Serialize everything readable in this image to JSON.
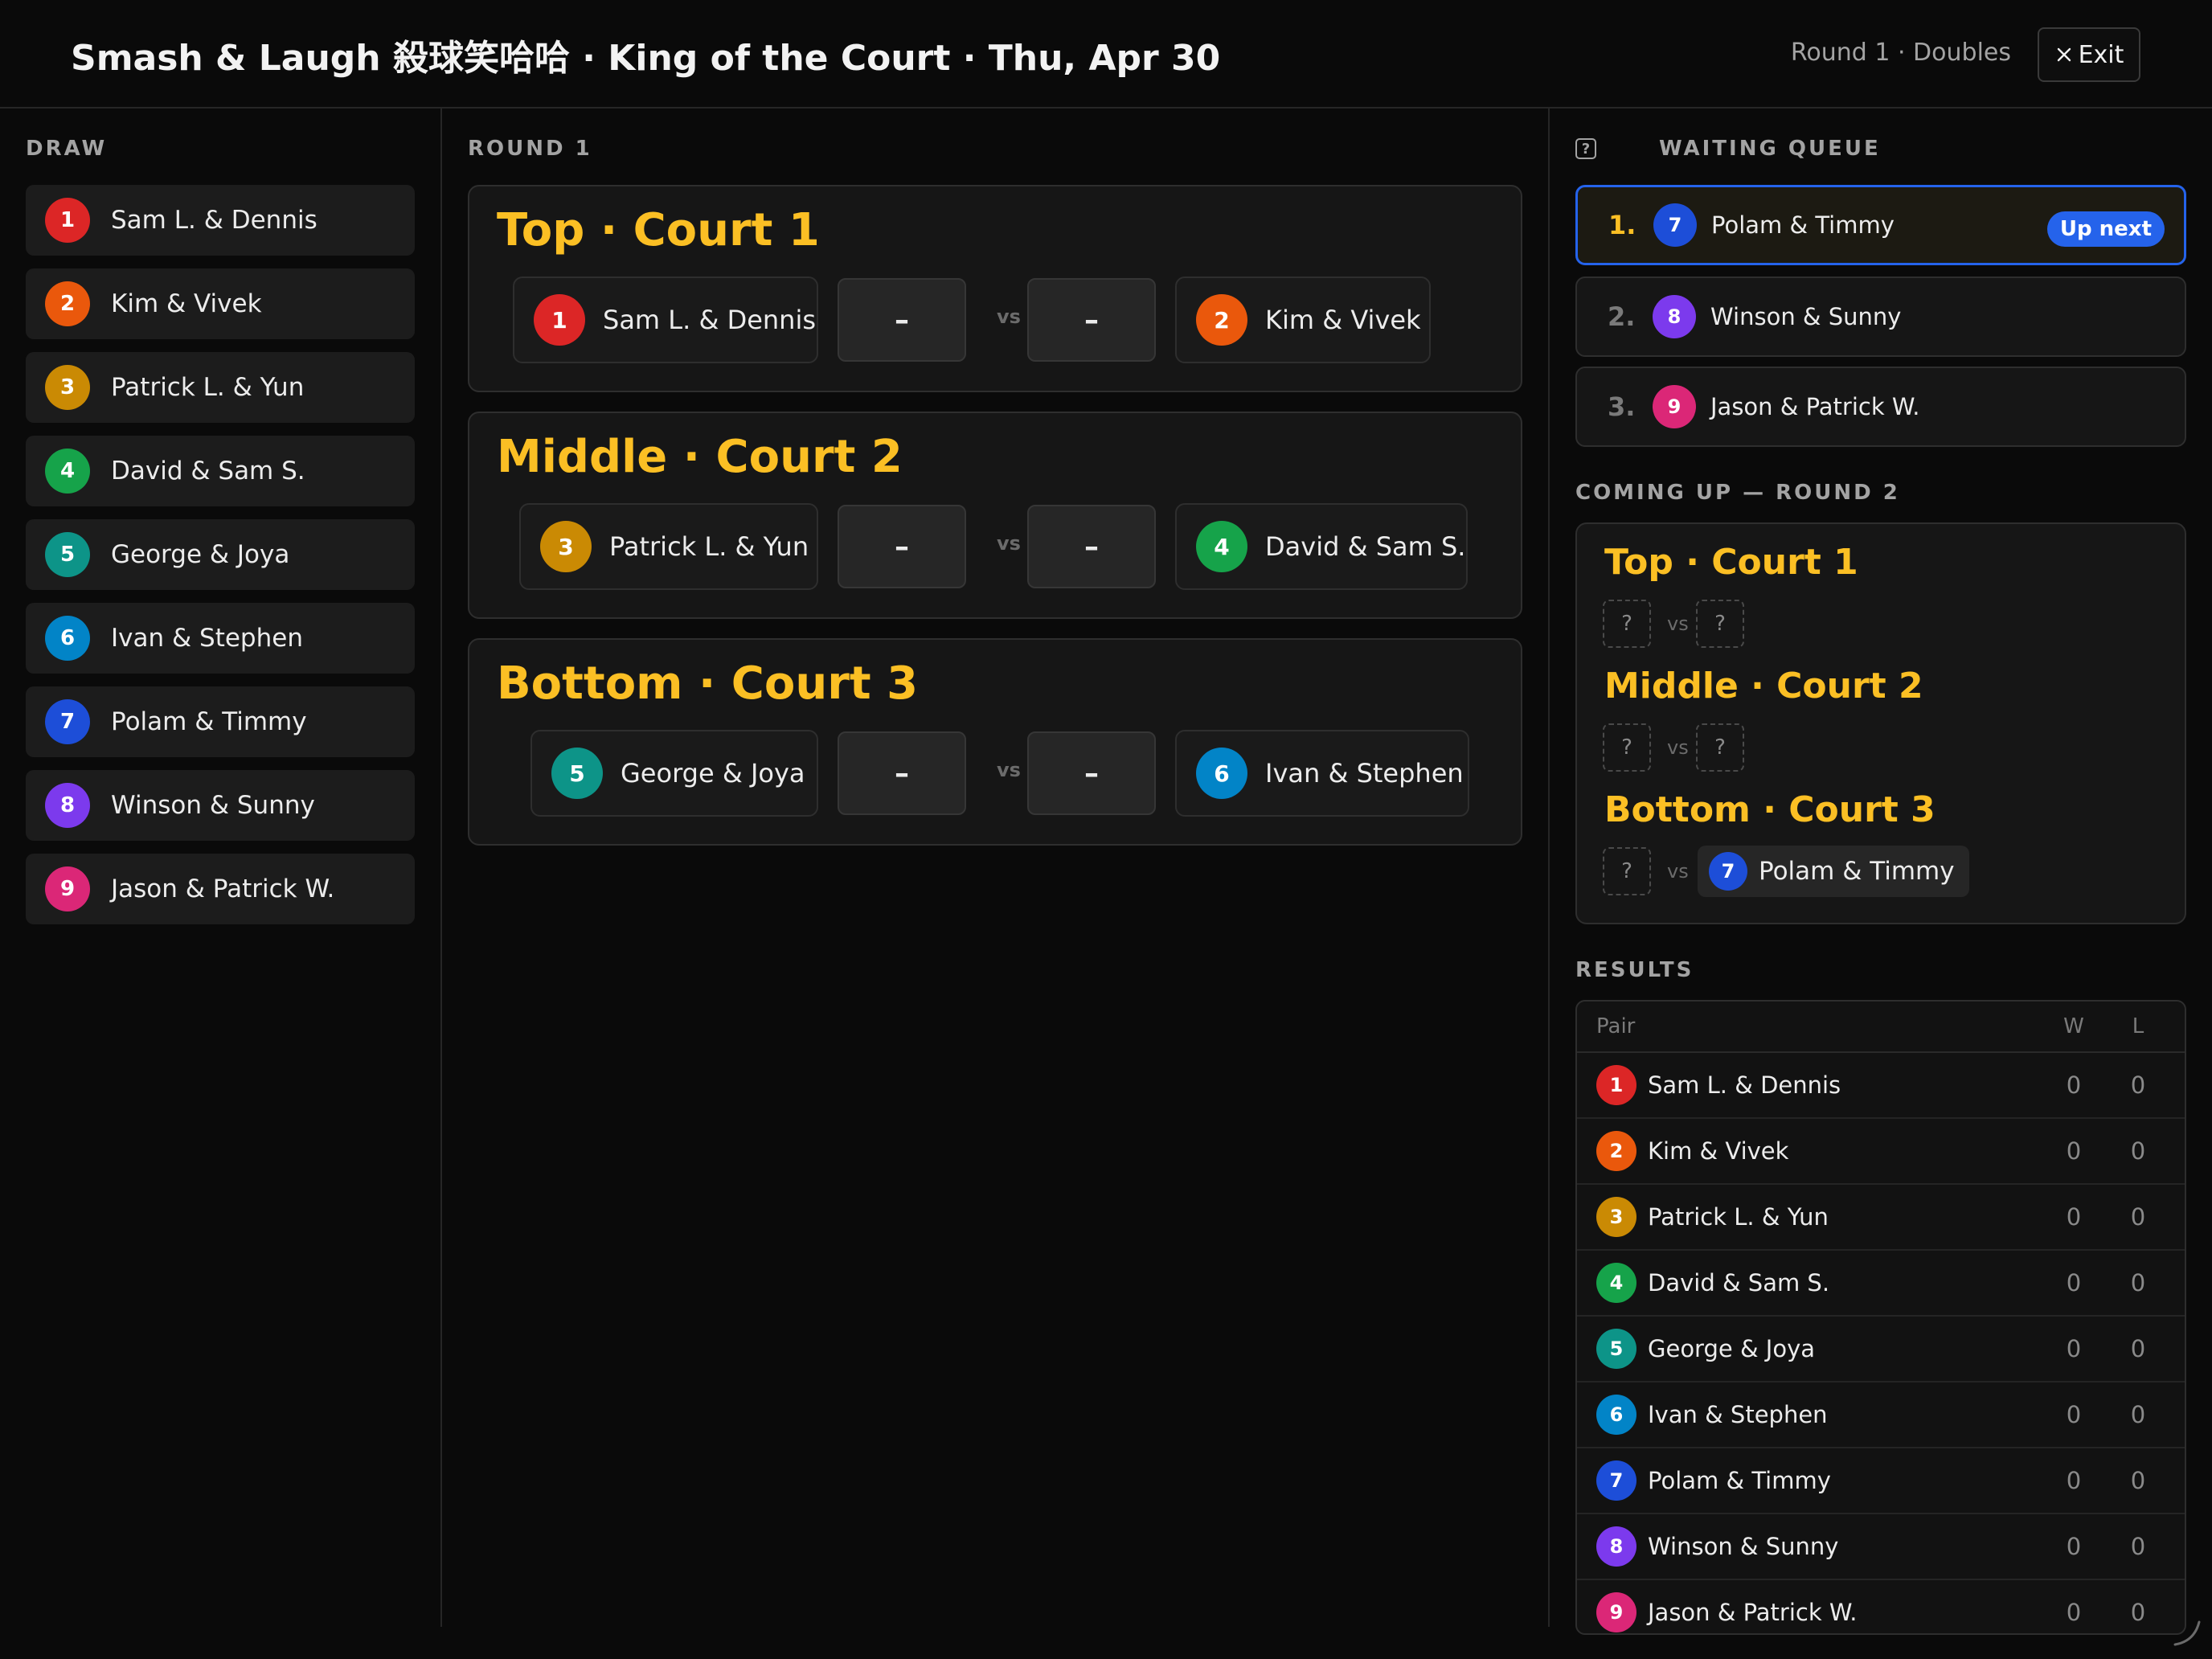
{
  "header": {
    "title": "Smash & Laugh 殺球笑哈哈 · King of the Court · Thu, Apr 30",
    "round_info": "Round 1 · Doubles",
    "exit_label": "Exit"
  },
  "draw": {
    "label": "DRAW",
    "items": [
      {
        "num": "1",
        "name": "Sam L. & Dennis",
        "color": "#dc2626"
      },
      {
        "num": "2",
        "name": "Kim & Vivek",
        "color": "#ea580c"
      },
      {
        "num": "3",
        "name": "Patrick L. & Yun",
        "color": "#ca8a04"
      },
      {
        "num": "4",
        "name": "David & Sam S.",
        "color": "#16a34a"
      },
      {
        "num": "5",
        "name": "George & Joya",
        "color": "#0d9488"
      },
      {
        "num": "6",
        "name": "Ivan & Stephen",
        "color": "#0284c7"
      },
      {
        "num": "7",
        "name": "Polam & Timmy",
        "color": "#1d4ed8"
      },
      {
        "num": "8",
        "name": "Winson & Sunny",
        "color": "#7c3aed"
      },
      {
        "num": "9",
        "name": "Jason & Patrick W.",
        "color": "#db2777"
      }
    ]
  },
  "round": {
    "label": "ROUND 1",
    "vs": "vs",
    "courts": [
      {
        "title": "Top · Court 1",
        "left": {
          "num": "1",
          "name": "Sam L. & Dennis",
          "color": "#dc2626"
        },
        "right": {
          "num": "2",
          "name": "Kim & Vivek",
          "color": "#ea580c"
        },
        "score_left": "–",
        "score_right": "–"
      },
      {
        "title": "Middle · Court 2",
        "left": {
          "num": "3",
          "name": "Patrick L. & Yun",
          "color": "#ca8a04"
        },
        "right": {
          "num": "4",
          "name": "David & Sam S.",
          "color": "#16a34a"
        },
        "score_left": "–",
        "score_right": "–"
      },
      {
        "title": "Bottom · Court 3",
        "left": {
          "num": "5",
          "name": "George & Joya",
          "color": "#0d9488"
        },
        "right": {
          "num": "6",
          "name": "Ivan & Stephen",
          "color": "#0284c7"
        },
        "score_left": "–",
        "score_right": "–"
      }
    ]
  },
  "queue": {
    "help_icon": "?",
    "label": "WAITING QUEUE",
    "up_next_label": "Up next",
    "items": [
      {
        "pos": "1.",
        "num": "7",
        "name": "Polam & Timmy",
        "color": "#1d4ed8"
      },
      {
        "pos": "2.",
        "num": "8",
        "name": "Winson & Sunny",
        "color": "#7c3aed"
      },
      {
        "pos": "3.",
        "num": "9",
        "name": "Jason & Patrick W.",
        "color": "#db2777"
      }
    ]
  },
  "coming_up": {
    "label": "COMING UP — ROUND 2",
    "unknown": "?",
    "vs": "vs",
    "courts": [
      {
        "title": "Top · Court 1"
      },
      {
        "title": "Middle · Court 2"
      },
      {
        "title": "Bottom · Court 3",
        "known_team": {
          "num": "7",
          "name": "Polam & Timmy",
          "color": "#1d4ed8"
        }
      }
    ]
  },
  "results": {
    "label": "RESULTS",
    "col_pair": "Pair",
    "col_w": "W",
    "col_l": "L",
    "rows": [
      {
        "num": "1",
        "name": "Sam L. & Dennis",
        "w": "0",
        "l": "0",
        "color": "#dc2626"
      },
      {
        "num": "2",
        "name": "Kim & Vivek",
        "w": "0",
        "l": "0",
        "color": "#ea580c"
      },
      {
        "num": "3",
        "name": "Patrick L. & Yun",
        "w": "0",
        "l": "0",
        "color": "#ca8a04"
      },
      {
        "num": "4",
        "name": "David & Sam S.",
        "w": "0",
        "l": "0",
        "color": "#16a34a"
      },
      {
        "num": "5",
        "name": "George & Joya",
        "w": "0",
        "l": "0",
        "color": "#0d9488"
      },
      {
        "num": "6",
        "name": "Ivan & Stephen",
        "w": "0",
        "l": "0",
        "color": "#0284c7"
      },
      {
        "num": "7",
        "name": "Polam & Timmy",
        "w": "0",
        "l": "0",
        "color": "#1d4ed8"
      },
      {
        "num": "8",
        "name": "Winson & Sunny",
        "w": "0",
        "l": "0",
        "color": "#7c3aed"
      },
      {
        "num": "9",
        "name": "Jason & Patrick W.",
        "w": "0",
        "l": "0",
        "color": "#db2777"
      }
    ]
  },
  "colors": {
    "accent": "#fbbf24",
    "highlight": "#2563eb",
    "background": "#0a0a0a"
  }
}
